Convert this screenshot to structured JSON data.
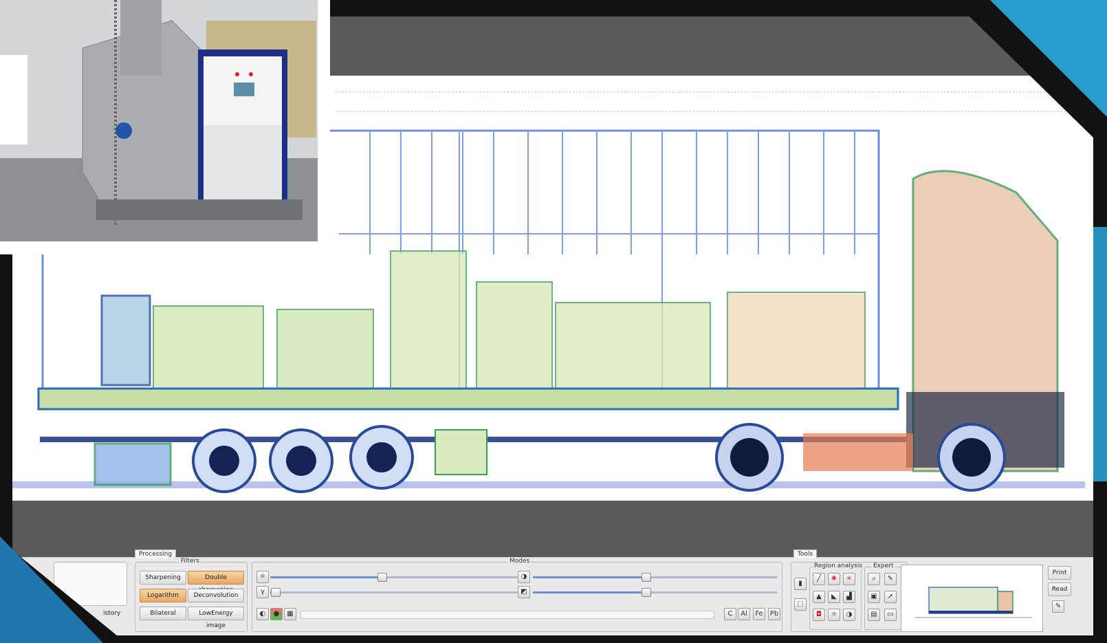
{
  "colors": {
    "background_accent": "#2a9fd0",
    "frame": "#111111",
    "button_highlight": "#e9a763"
  },
  "panel": {
    "processing_tab": "Processing",
    "filters_title": "Filters",
    "filters": {
      "sharpening": "Sharpening",
      "double_sharpening": "Double sharpening",
      "logarithm": "Logarithm",
      "deconvolution": "Deconvolution",
      "bilateral": "Bilateral",
      "low_energy": "LowEnergy image"
    },
    "history_label": "istory",
    "modes_title": "Modes",
    "sliders": {
      "brightness": 0.45,
      "contrast": 0.46,
      "gamma": 0.02,
      "saturation": 0.46
    },
    "tools_tab": "Tools",
    "region_title": "Region analysis",
    "expert_title": "Expert",
    "print_btn": "Print",
    "read_btn": "Read"
  }
}
